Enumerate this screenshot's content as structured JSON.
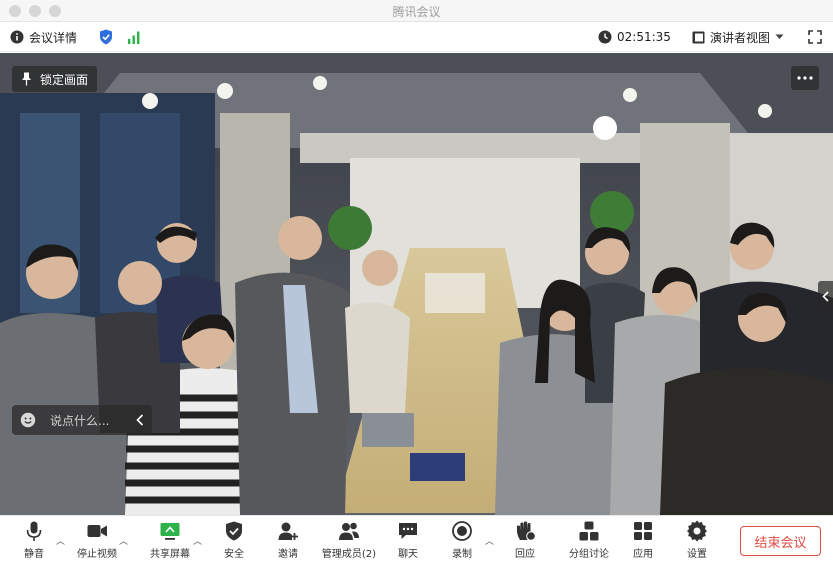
{
  "window": {
    "title": "腾讯会议"
  },
  "infobar": {
    "meeting_info": "会议详情",
    "timer": "02:51:35",
    "view_mode": "演讲者视图"
  },
  "video": {
    "pin_label": "锁定画面",
    "chat_placeholder": "说点什么..."
  },
  "toolbar": {
    "mute": "静音",
    "stop_video": "停止视频",
    "share_screen": "共享屏幕",
    "security": "安全",
    "invite": "邀请",
    "participants": "管理成员(2)",
    "chat": "聊天",
    "record": "录制",
    "reactions": "回应",
    "breakout": "分组讨论",
    "apps": "应用",
    "settings": "设置",
    "end_meeting": "结束会议"
  },
  "colors": {
    "accent_red": "#e04b43",
    "shield_blue": "#2f6fdc",
    "signal_green": "#2db24a"
  }
}
